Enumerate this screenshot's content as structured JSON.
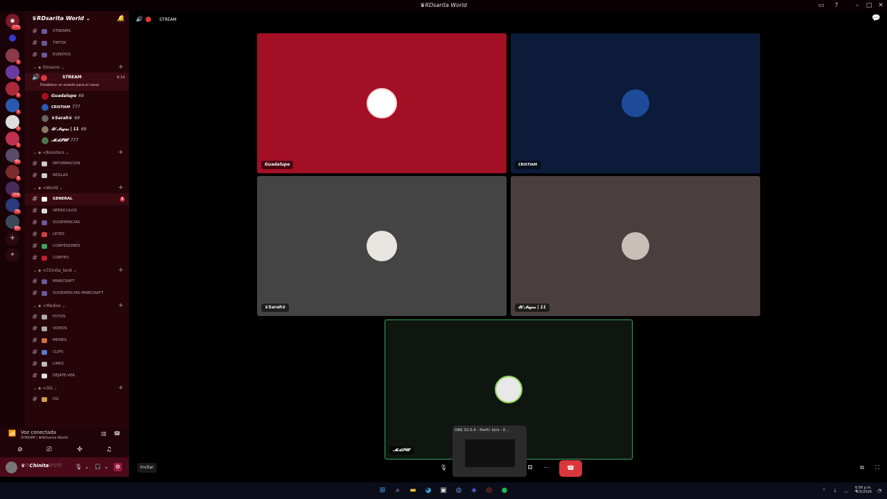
{
  "window": {
    "title": "♛RDsarita World"
  },
  "server": {
    "name": "♛RDsarita World"
  },
  "topbar": {
    "channel": "STREAM"
  },
  "rail_badges": [
    "171",
    "1",
    "1",
    "1",
    "1",
    "1",
    "1",
    "40",
    "8",
    "208",
    "79",
    "60"
  ],
  "channels_top": [
    {
      "name": "STREAMS"
    },
    {
      "name": "TIKTOK"
    },
    {
      "name": "EVENTOS"
    }
  ],
  "cat_streams": "Streams",
  "stream_channel": {
    "name": "STREAM",
    "time": "6:14",
    "status": "Establece un estado para el canal"
  },
  "voice_users": [
    {
      "name": "Guadalupe",
      "extra": "69"
    },
    {
      "name": "CRISTIAM",
      "extra": "777"
    },
    {
      "name": "♛Sarah♛",
      "extra": "69"
    },
    {
      "name": "𝓔𝓵 𝓝𝓮𝓰𝓻𝓸 | 11",
      "extra": "69"
    },
    {
      "name": "𝓜𝓐𝓘𝓒𝓞",
      "extra": "777"
    }
  ],
  "cat_boosters": "Boosters",
  "channels_boosters": [
    {
      "name": "INFORMACION"
    },
    {
      "name": "REGLAS"
    }
  ],
  "cat_world": "World",
  "channels_world": [
    {
      "name": "GENERAL",
      "active": true,
      "ping": "1"
    },
    {
      "name": "VERSICULOS"
    },
    {
      "name": "SUGERENCIAS"
    },
    {
      "name": "LEYES"
    },
    {
      "name": "CONFESIONES"
    },
    {
      "name": "CONTEO"
    }
  ],
  "cat_chinita": "Chinita_land",
  "channels_chinita": [
    {
      "name": "MINECRAFT"
    },
    {
      "name": "SUGERENCIAS-MINECRAFT"
    }
  ],
  "cat_medios": "Medios",
  "channels_medios": [
    {
      "name": "FOTOS"
    },
    {
      "name": "VIDEOS"
    },
    {
      "name": "MEMES"
    },
    {
      "name": "CLIPS"
    },
    {
      "name": "LINKS"
    },
    {
      "name": "DEJATE-VER"
    }
  ],
  "cat_og": "OG",
  "channels_og": [
    {
      "name": "OG"
    }
  ],
  "voice_status": {
    "title": "Voz conectada",
    "sub": "STREAM / ♛RDsarita World"
  },
  "user": {
    "name": "♛♡Chinita♡♡♡"
  },
  "tiles": [
    {
      "name": "Guadalupe",
      "color": "#a30f25"
    },
    {
      "name": "CRISTIAM",
      "color": "#0c1b3a"
    },
    {
      "name": "♛Sarah♛",
      "color": "#444444"
    },
    {
      "name": "𝓔𝓵 𝓝𝓮𝓰𝓻𝓸 | 11",
      "color": "#4a3e3e"
    },
    {
      "name": "𝓜𝓐𝓘𝓒𝓞",
      "color": "#0f150f"
    }
  ],
  "invite_label": "Invitar",
  "obs_thumb": {
    "title": "OBS 32.0.4 - Perfil: kick - E..."
  },
  "clock": {
    "time": "6:56 p.m.",
    "date": "5/5/2026"
  }
}
